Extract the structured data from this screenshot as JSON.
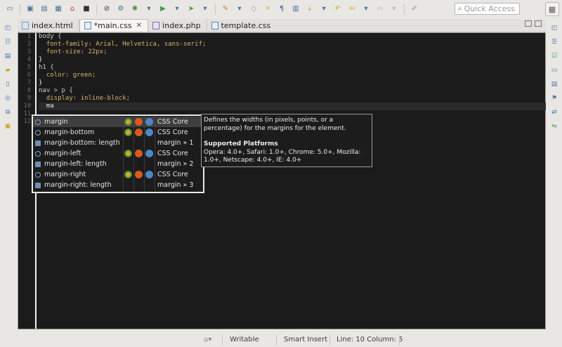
{
  "toolbar": {
    "quick_access_placeholder": "Quick Access"
  },
  "tabs": [
    {
      "label": "index.html",
      "active": false,
      "dirty": false
    },
    {
      "label": "*main.css",
      "active": true,
      "dirty": true,
      "close": "✕"
    },
    {
      "label": "index.php",
      "active": false,
      "dirty": false
    },
    {
      "label": "template.css",
      "active": false,
      "dirty": false
    }
  ],
  "editor": {
    "line_numbers": [
      "1",
      "2",
      "3",
      "4",
      "5",
      "6",
      "7",
      "8",
      "9",
      "10",
      "11",
      "12"
    ],
    "lines": [
      "body {",
      "  font-family: Arial, Helvetica, sans-serif;",
      "  font-size: 22px;",
      "}",
      "h1 {",
      "  color: green;",
      "}",
      "nav > p {",
      "  display: inline-block;",
      "  ma",
      "",
      ""
    ],
    "current_line": 10
  },
  "completion": {
    "items": [
      {
        "name": "margin",
        "icon": "property-icon",
        "browsers": true,
        "source": "CSS Core",
        "selected": true
      },
      {
        "name": "margin-bottom",
        "icon": "property-icon",
        "browsers": true,
        "source": "CSS Core",
        "selected": false
      },
      {
        "name": "margin-bottom: length",
        "icon": "template-icon",
        "browsers": false,
        "source": "margin » 1",
        "selected": false
      },
      {
        "name": "margin-left",
        "icon": "property-icon",
        "browsers": true,
        "source": "CSS Core",
        "selected": false
      },
      {
        "name": "margin-left: length",
        "icon": "template-icon",
        "browsers": false,
        "source": "margin » 2",
        "selected": false
      },
      {
        "name": "margin-right",
        "icon": "property-icon",
        "browsers": true,
        "source": "CSS Core",
        "selected": false
      },
      {
        "name": "margin-right: length",
        "icon": "template-icon",
        "browsers": false,
        "source": "margin » 3",
        "selected": false
      }
    ]
  },
  "doc": {
    "description": "Defines the widths (in pixels, points, or a percentage) for the margins for the element.",
    "heading": "Supported Platforms",
    "platforms": "Opera: 4.0+, Safari: 1.0+, Chrome: 5.0+, Mozilla: 1.0+, Netscape: 4.0+, IE: 4.0+"
  },
  "status": {
    "mode": "Writable",
    "insert": "Smart Insert",
    "position": "Line: 10 Column: 5"
  },
  "colors": {
    "editor_bg": "#1b1b1b",
    "keyword": "#d8b46a",
    "accent": "#4a6f97"
  }
}
